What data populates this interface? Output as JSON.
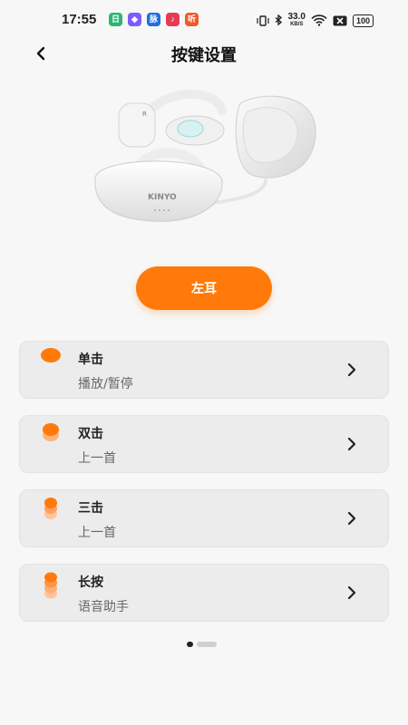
{
  "status": {
    "time": "17:55",
    "notifications": [
      {
        "name": "calendar-notif-icon",
        "glyph": "日",
        "color": "#2bb673"
      },
      {
        "name": "app-notif-icon",
        "glyph": "◆",
        "color": "#7c5cff"
      },
      {
        "name": "news-notif-icon",
        "glyph": "脉",
        "color": "#1e6fe0"
      },
      {
        "name": "music-notif-icon",
        "glyph": "♪",
        "color": "#e53b55"
      },
      {
        "name": "listen-notif-icon",
        "glyph": "听",
        "color": "#f05a28"
      }
    ],
    "speed_value": "33.0",
    "speed_unit": "KB/S",
    "battery": "100"
  },
  "header": {
    "title": "按键设置",
    "back_icon": "chevron-left-icon"
  },
  "product": {
    "brand_print": "KINYO"
  },
  "ear_button": {
    "label": "左耳",
    "color": "#ff7a0a"
  },
  "actions": [
    {
      "title": "单击",
      "value": "播放/暂停",
      "dots": 1
    },
    {
      "title": "双击",
      "value": "上一首",
      "dots": 2
    },
    {
      "title": "三击",
      "value": "上一首",
      "dots": 3
    },
    {
      "title": "长按",
      "value": "语音助手",
      "dots": 4
    }
  ],
  "pager": {
    "count": 2,
    "active": 0
  }
}
